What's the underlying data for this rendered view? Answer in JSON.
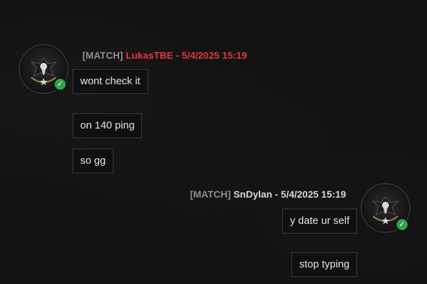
{
  "messages": [
    {
      "tag": "[MATCH]",
      "user": "LukasTBE",
      "separator": " - ",
      "timestamp": "5/4/2025 15:19",
      "side": "left",
      "user_color": "#e2393b",
      "lines": [
        "wont check it",
        "on 140 ping",
        "so gg"
      ],
      "avatar_icon": "eagle-emblem-icon",
      "status_icon": "online-check-icon"
    },
    {
      "tag": "[MATCH]",
      "user": "SnDylan",
      "separator": " - ",
      "timestamp": "5/4/2025 15:19",
      "side": "right",
      "user_color": "#d9d9d9",
      "lines": [
        "y date ur self",
        "stop typing"
      ],
      "avatar_icon": "eagle-emblem-icon",
      "status_icon": "online-check-icon"
    }
  ],
  "status_glyph": "✓"
}
